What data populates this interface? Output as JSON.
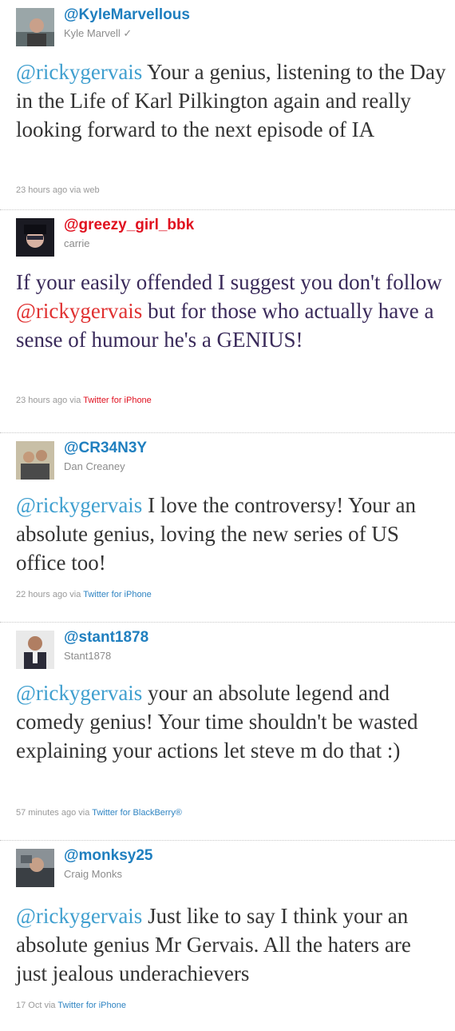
{
  "tweets": [
    {
      "handle": "@KyleMarvellous",
      "name": "Kyle Marvell",
      "verified_mark": "✓",
      "mention": "@rickygervais",
      "text_before": "",
      "text_after": " Your a genius, listening to the Day in the Life of Karl Pilkington again and really looking forward to the next episode of IA",
      "time": "23 hours ago",
      "via": " via ",
      "source": "web",
      "handle_color": "#1f7fbf",
      "text_color": "#333333",
      "mention_color": "#3f9fcf",
      "source_color": "#999999"
    },
    {
      "handle": "@greezy_girl_bbk",
      "name": "carrie",
      "mention": "@rickygervais",
      "text_before": "If your easily offended I suggest you don't follow ",
      "text_after": " but for those who actually have a sense of humour he's a GENIUS!",
      "time": "23 hours ago",
      "via": " via ",
      "source": "Twitter for iPhone",
      "handle_color": "#e0101f",
      "text_color": "#3a2a5a",
      "mention_color": "#e03030",
      "source_color": "#e0101f"
    },
    {
      "handle": "@CR34N3Y",
      "name": "Dan Creaney",
      "mention": "@rickygervais",
      "text_before": "",
      "text_after": " I love the controversy! Your an absolute genius, loving the new series of US office too!",
      "time": "22 hours ago",
      "via": " via ",
      "source": "Twitter for iPhone",
      "handle_color": "#1f7fbf",
      "text_color": "#333333",
      "mention_color": "#3f9fcf",
      "source_color": "#2f84c2"
    },
    {
      "handle": "@stant1878",
      "name": "Stant1878",
      "mention": "@rickygervais",
      "text_before": "",
      "text_after": " your an absolute legend and comedy genius! Your time shouldn't be wasted explaining your actions let steve m do that :)",
      "time": "57 minutes ago",
      "via": " via ",
      "source": "Twitter for BlackBerry®",
      "handle_color": "#1f7fbf",
      "text_color": "#333333",
      "mention_color": "#3f9fcf",
      "source_color": "#2f84c2"
    },
    {
      "handle": "@monksy25",
      "name": "Craig Monks",
      "mention": "@rickygervais",
      "text_before": "",
      "text_after": " Just like to say I think your an absolute genius Mr Gervais. All the haters are just jealous underachievers",
      "time": "17 Oct",
      "via": " via ",
      "source": "Twitter for iPhone",
      "handle_color": "#1f7fbf",
      "text_color": "#333333",
      "mention_color": "#3f9fcf",
      "source_color": "#2f84c2"
    }
  ]
}
